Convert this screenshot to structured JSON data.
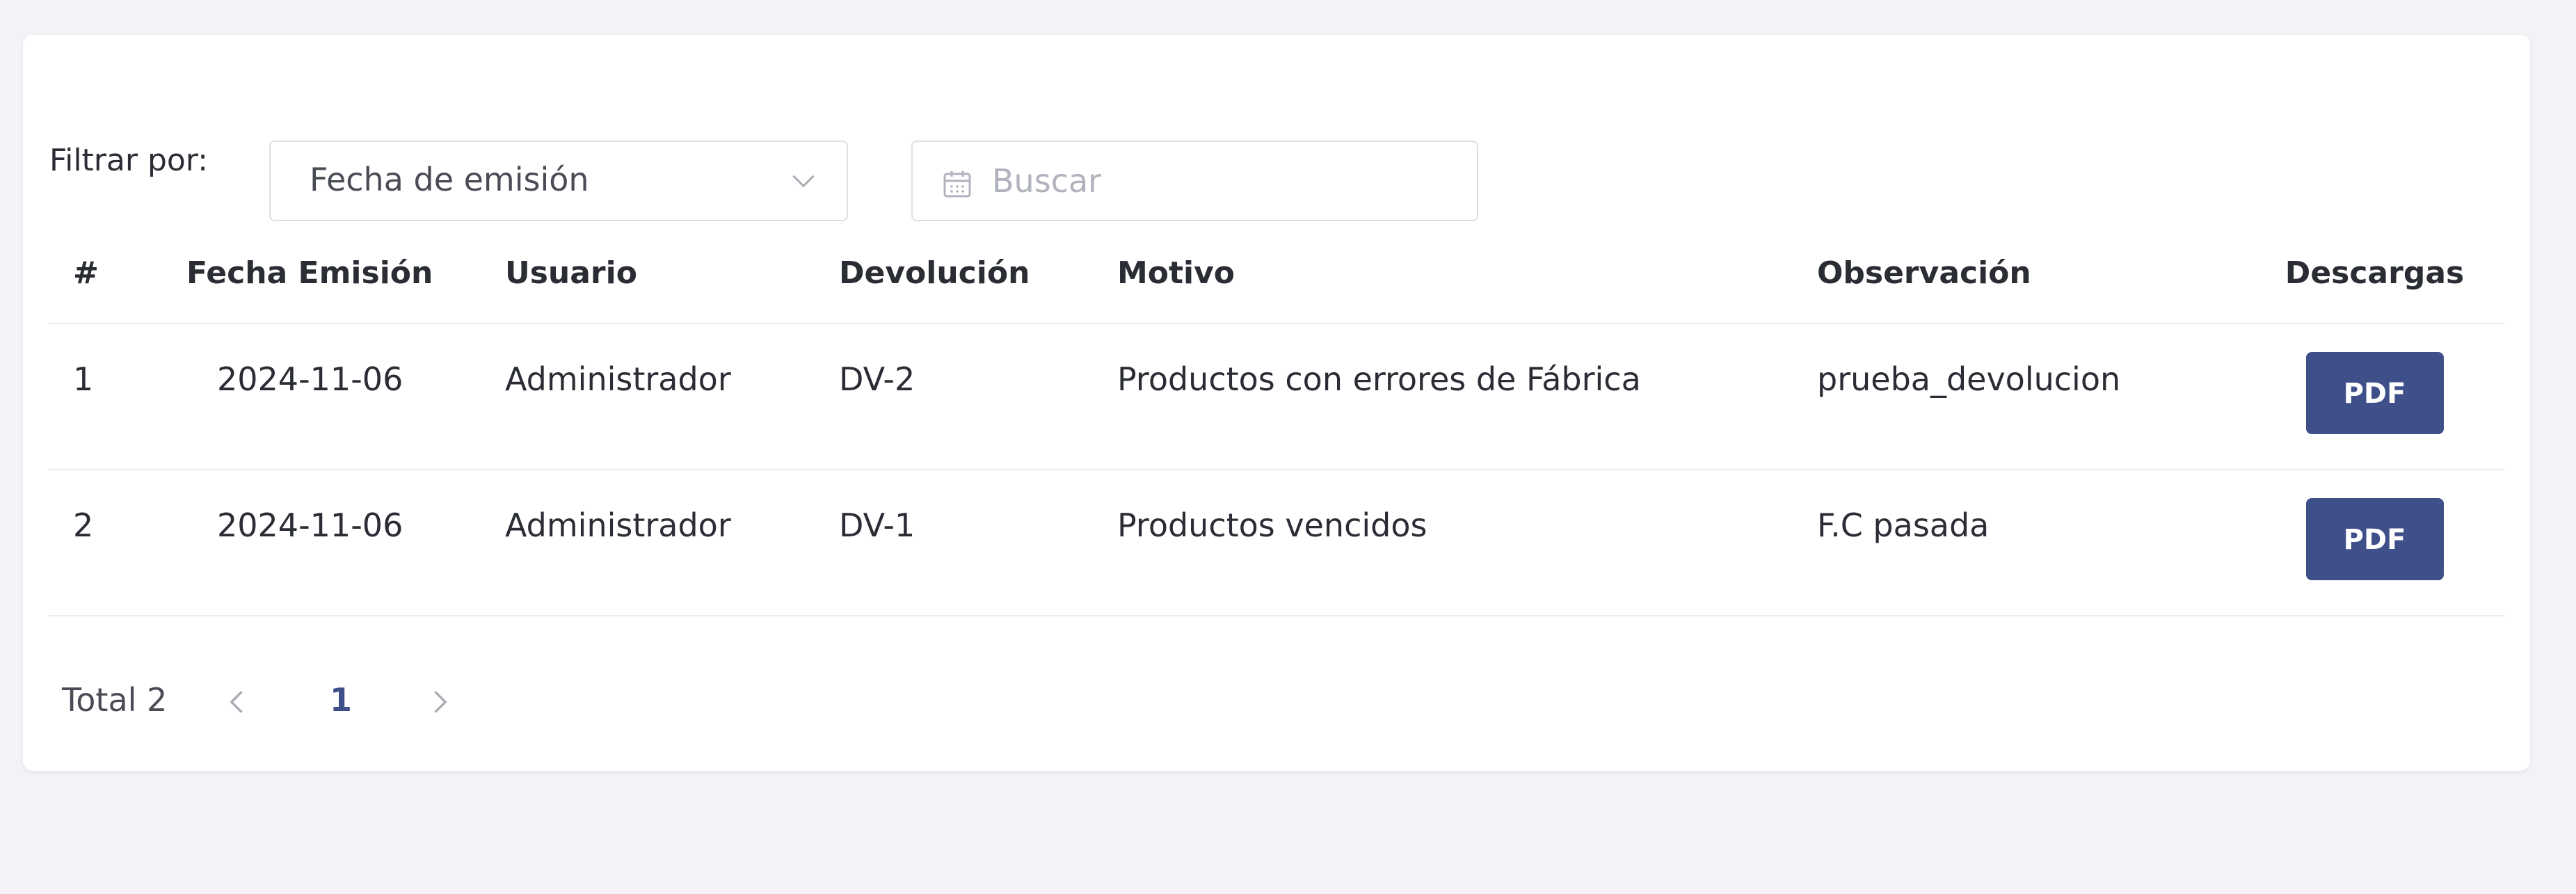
{
  "filter": {
    "label": "Filtrar por:",
    "select_value": "Fecha de emisión",
    "search_placeholder": "Buscar"
  },
  "table": {
    "headers": {
      "num": "#",
      "fecha": "Fecha Emisión",
      "usuario": "Usuario",
      "devolucion": "Devolución",
      "motivo": "Motivo",
      "observacion": "Observación",
      "descargas": "Descargas"
    },
    "rows": [
      {
        "num": "1",
        "fecha": "2024-11-06",
        "usuario": "Administrador",
        "devolucion": "DV-2",
        "motivo": "Productos con errores de Fábrica",
        "observacion": "prueba_devolucion",
        "download_label": "PDF"
      },
      {
        "num": "2",
        "fecha": "2024-11-06",
        "usuario": "Administrador",
        "devolucion": "DV-1",
        "motivo": "Productos vencidos",
        "observacion": "F.C pasada",
        "download_label": "PDF"
      }
    ]
  },
  "pagination": {
    "total_label": "Total 2",
    "current_page": "1",
    "prev_icon": "chevron-left-icon",
    "next_icon": "chevron-right-icon"
  },
  "colors": {
    "page_bg": "#f2f2f7",
    "card_bg": "#ffffff",
    "accent": "#3f4f8a",
    "border": "#dcdfe6"
  }
}
